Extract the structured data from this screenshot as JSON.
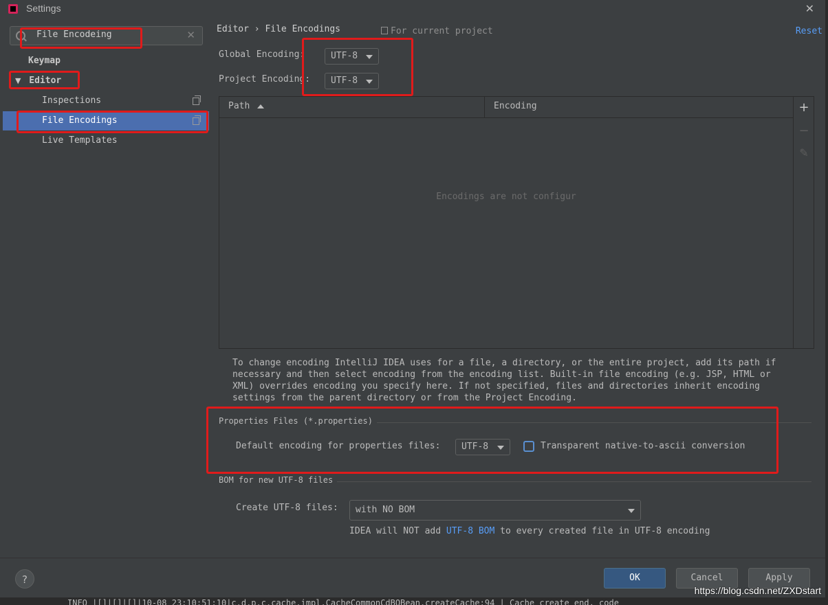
{
  "window": {
    "title": "Settings"
  },
  "search": {
    "value": "File Encodeing"
  },
  "tree": {
    "keymap": "Keymap",
    "editor": "Editor",
    "editor_expand": "▼",
    "children": [
      "Inspections",
      "File Encodings",
      "Live Templates"
    ]
  },
  "header": {
    "breadcrumb": "Editor › File Encodings",
    "scope": "For current project",
    "reset": "Reset"
  },
  "global_encoding": {
    "label": "Global Encoding:",
    "value": "UTF-8"
  },
  "project_encoding": {
    "label": "Project Encoding:",
    "value": "UTF-8"
  },
  "table": {
    "columns": [
      "Path",
      "Encoding"
    ],
    "empty_text": "Encodings are not configur",
    "toolbar": [
      "+",
      "−",
      "✎"
    ]
  },
  "help_text": [
    "To change encoding IntelliJ IDEA uses for a file, a directory, or the entire project, add its path if",
    "necessary and then select encoding from the encoding list. Built-in file encoding (e.g. JSP, HTML or",
    "XML) overrides encoding you specify here. If not specified, files and directories inherit encoding",
    "settings from the parent directory or from the Project Encoding."
  ],
  "properties": {
    "section": "Properties Files (*.properties)",
    "label": "Default encoding for properties files:",
    "value": "UTF-8",
    "checkbox_label": "Transparent native-to-ascii conversion",
    "checked": false
  },
  "bom": {
    "section": "BOM for new UTF-8 files",
    "label": "Create UTF-8 files:",
    "value": "with NO BOM",
    "note_before": "IDEA will NOT add ",
    "note_link": "UTF-8 BOM",
    "note_after": " to every created file in UTF-8 encoding"
  },
  "buttons": {
    "help": "?",
    "ok": "OK",
    "cancel": "Cancel",
    "apply": "Apply"
  },
  "background_log": "INFO |[]|[]|[]|10-08 23:10:51:10|c.d.p.c.cache.impl.CacheCommonCdBOBean.createCache:94 | Cache create end, code",
  "watermark": "https://blog.csdn.net/ZXDstart",
  "colors": {
    "accent": "#4b6eaf",
    "link": "#589df6",
    "annotation": "#e01b1b"
  }
}
